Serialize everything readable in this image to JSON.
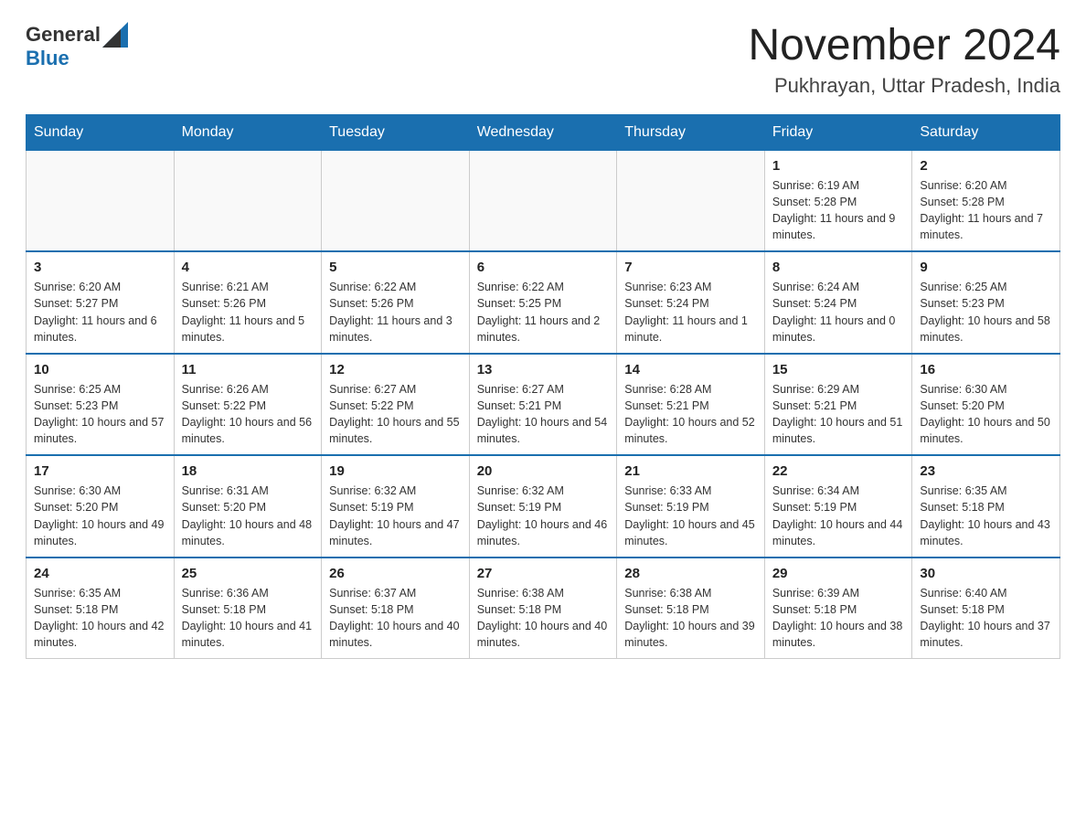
{
  "header": {
    "logo_general": "General",
    "logo_blue": "Blue",
    "month_title": "November 2024",
    "location": "Pukhrayan, Uttar Pradesh, India"
  },
  "weekdays": [
    "Sunday",
    "Monday",
    "Tuesday",
    "Wednesday",
    "Thursday",
    "Friday",
    "Saturday"
  ],
  "weeks": [
    [
      {
        "day": "",
        "info": ""
      },
      {
        "day": "",
        "info": ""
      },
      {
        "day": "",
        "info": ""
      },
      {
        "day": "",
        "info": ""
      },
      {
        "day": "",
        "info": ""
      },
      {
        "day": "1",
        "info": "Sunrise: 6:19 AM\nSunset: 5:28 PM\nDaylight: 11 hours and 9 minutes."
      },
      {
        "day": "2",
        "info": "Sunrise: 6:20 AM\nSunset: 5:28 PM\nDaylight: 11 hours and 7 minutes."
      }
    ],
    [
      {
        "day": "3",
        "info": "Sunrise: 6:20 AM\nSunset: 5:27 PM\nDaylight: 11 hours and 6 minutes."
      },
      {
        "day": "4",
        "info": "Sunrise: 6:21 AM\nSunset: 5:26 PM\nDaylight: 11 hours and 5 minutes."
      },
      {
        "day": "5",
        "info": "Sunrise: 6:22 AM\nSunset: 5:26 PM\nDaylight: 11 hours and 3 minutes."
      },
      {
        "day": "6",
        "info": "Sunrise: 6:22 AM\nSunset: 5:25 PM\nDaylight: 11 hours and 2 minutes."
      },
      {
        "day": "7",
        "info": "Sunrise: 6:23 AM\nSunset: 5:24 PM\nDaylight: 11 hours and 1 minute."
      },
      {
        "day": "8",
        "info": "Sunrise: 6:24 AM\nSunset: 5:24 PM\nDaylight: 11 hours and 0 minutes."
      },
      {
        "day": "9",
        "info": "Sunrise: 6:25 AM\nSunset: 5:23 PM\nDaylight: 10 hours and 58 minutes."
      }
    ],
    [
      {
        "day": "10",
        "info": "Sunrise: 6:25 AM\nSunset: 5:23 PM\nDaylight: 10 hours and 57 minutes."
      },
      {
        "day": "11",
        "info": "Sunrise: 6:26 AM\nSunset: 5:22 PM\nDaylight: 10 hours and 56 minutes."
      },
      {
        "day": "12",
        "info": "Sunrise: 6:27 AM\nSunset: 5:22 PM\nDaylight: 10 hours and 55 minutes."
      },
      {
        "day": "13",
        "info": "Sunrise: 6:27 AM\nSunset: 5:21 PM\nDaylight: 10 hours and 54 minutes."
      },
      {
        "day": "14",
        "info": "Sunrise: 6:28 AM\nSunset: 5:21 PM\nDaylight: 10 hours and 52 minutes."
      },
      {
        "day": "15",
        "info": "Sunrise: 6:29 AM\nSunset: 5:21 PM\nDaylight: 10 hours and 51 minutes."
      },
      {
        "day": "16",
        "info": "Sunrise: 6:30 AM\nSunset: 5:20 PM\nDaylight: 10 hours and 50 minutes."
      }
    ],
    [
      {
        "day": "17",
        "info": "Sunrise: 6:30 AM\nSunset: 5:20 PM\nDaylight: 10 hours and 49 minutes."
      },
      {
        "day": "18",
        "info": "Sunrise: 6:31 AM\nSunset: 5:20 PM\nDaylight: 10 hours and 48 minutes."
      },
      {
        "day": "19",
        "info": "Sunrise: 6:32 AM\nSunset: 5:19 PM\nDaylight: 10 hours and 47 minutes."
      },
      {
        "day": "20",
        "info": "Sunrise: 6:32 AM\nSunset: 5:19 PM\nDaylight: 10 hours and 46 minutes."
      },
      {
        "day": "21",
        "info": "Sunrise: 6:33 AM\nSunset: 5:19 PM\nDaylight: 10 hours and 45 minutes."
      },
      {
        "day": "22",
        "info": "Sunrise: 6:34 AM\nSunset: 5:19 PM\nDaylight: 10 hours and 44 minutes."
      },
      {
        "day": "23",
        "info": "Sunrise: 6:35 AM\nSunset: 5:18 PM\nDaylight: 10 hours and 43 minutes."
      }
    ],
    [
      {
        "day": "24",
        "info": "Sunrise: 6:35 AM\nSunset: 5:18 PM\nDaylight: 10 hours and 42 minutes."
      },
      {
        "day": "25",
        "info": "Sunrise: 6:36 AM\nSunset: 5:18 PM\nDaylight: 10 hours and 41 minutes."
      },
      {
        "day": "26",
        "info": "Sunrise: 6:37 AM\nSunset: 5:18 PM\nDaylight: 10 hours and 40 minutes."
      },
      {
        "day": "27",
        "info": "Sunrise: 6:38 AM\nSunset: 5:18 PM\nDaylight: 10 hours and 40 minutes."
      },
      {
        "day": "28",
        "info": "Sunrise: 6:38 AM\nSunset: 5:18 PM\nDaylight: 10 hours and 39 minutes."
      },
      {
        "day": "29",
        "info": "Sunrise: 6:39 AM\nSunset: 5:18 PM\nDaylight: 10 hours and 38 minutes."
      },
      {
        "day": "30",
        "info": "Sunrise: 6:40 AM\nSunset: 5:18 PM\nDaylight: 10 hours and 37 minutes."
      }
    ]
  ]
}
